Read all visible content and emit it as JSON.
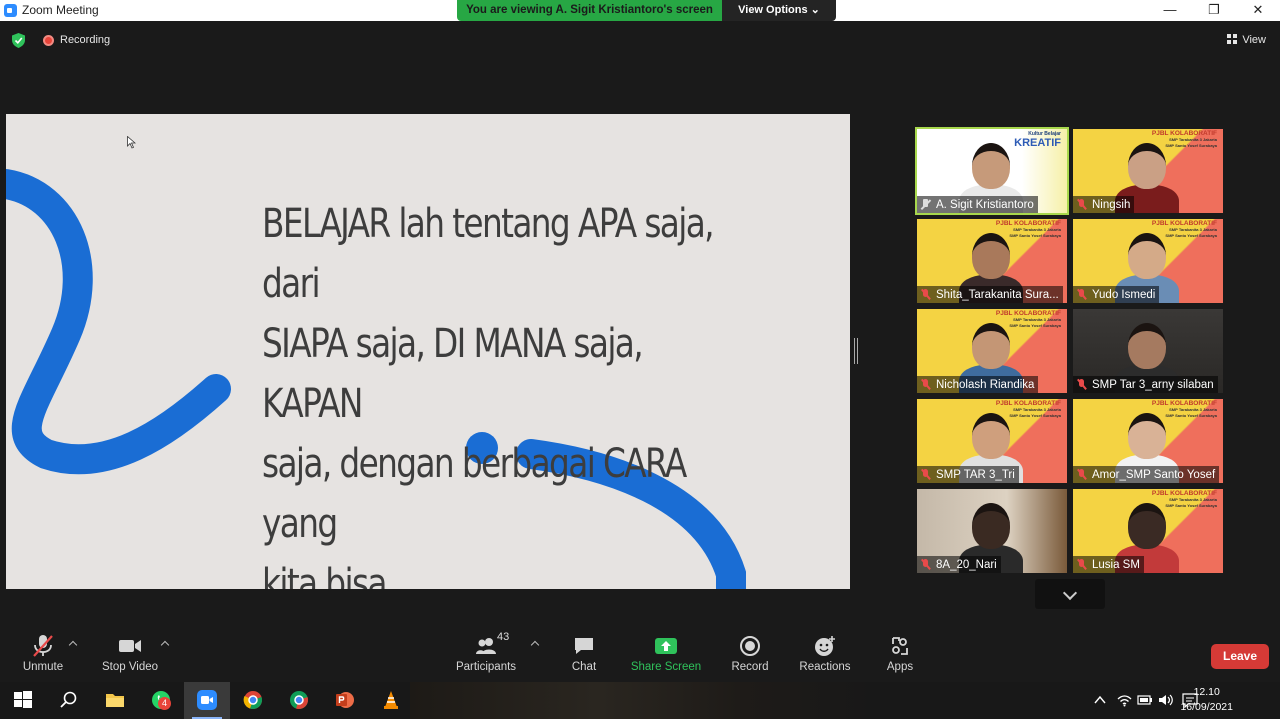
{
  "window": {
    "title": "Zoom Meeting",
    "minimize": "—",
    "restore": "❐",
    "close": "✕"
  },
  "share_banner": {
    "viewing_text": "You are viewing A. Sigit Kristiantoro's screen",
    "view_options_label": "View Options ⌄"
  },
  "status": {
    "recording_label": "Recording",
    "view_label": "View"
  },
  "slide": {
    "text": "BELAJAR lah tentang APA saja, dari\nSIAPA saja, DI MANA saja, KAPAN\nsaja, dengan berbagai CARA yang\nkita bisa",
    "accent_color": "#1a6dd4"
  },
  "participants": [
    {
      "name": "A. Sigit Kristiantoro",
      "active": true
    },
    {
      "name": "Ningsih"
    },
    {
      "name": "Shita_Tarakanita Sura..."
    },
    {
      "name": "Yudo Ismedi"
    },
    {
      "name": "Nicholash Riandika"
    },
    {
      "name": "SMP Tar 3_arny silaban"
    },
    {
      "name": "SMP TAR 3_Tri"
    },
    {
      "name": "Amor_SMP Santo Yosef"
    },
    {
      "name": "8A_20_Nari"
    },
    {
      "name": "Lusia SM"
    }
  ],
  "tile_banner": {
    "kreatif": "KREATIF",
    "kultur": "Kultur Belajar",
    "pjbl": "PJBL KOLABORATIF",
    "school1": "SMP Tarakanita 3 Jakarta",
    "school2": "SMP Santo Yosef Surabaya"
  },
  "toolbar": {
    "unmute": "Unmute",
    "stop_video": "Stop Video",
    "participants": "Participants",
    "participant_count": "43",
    "chat": "Chat",
    "share_screen": "Share Screen",
    "record": "Record",
    "reactions": "Reactions",
    "apps": "Apps",
    "leave": "Leave"
  },
  "taskbar": {
    "time": "12.10",
    "date": "16/09/2021",
    "whatsapp_badge": "4"
  }
}
